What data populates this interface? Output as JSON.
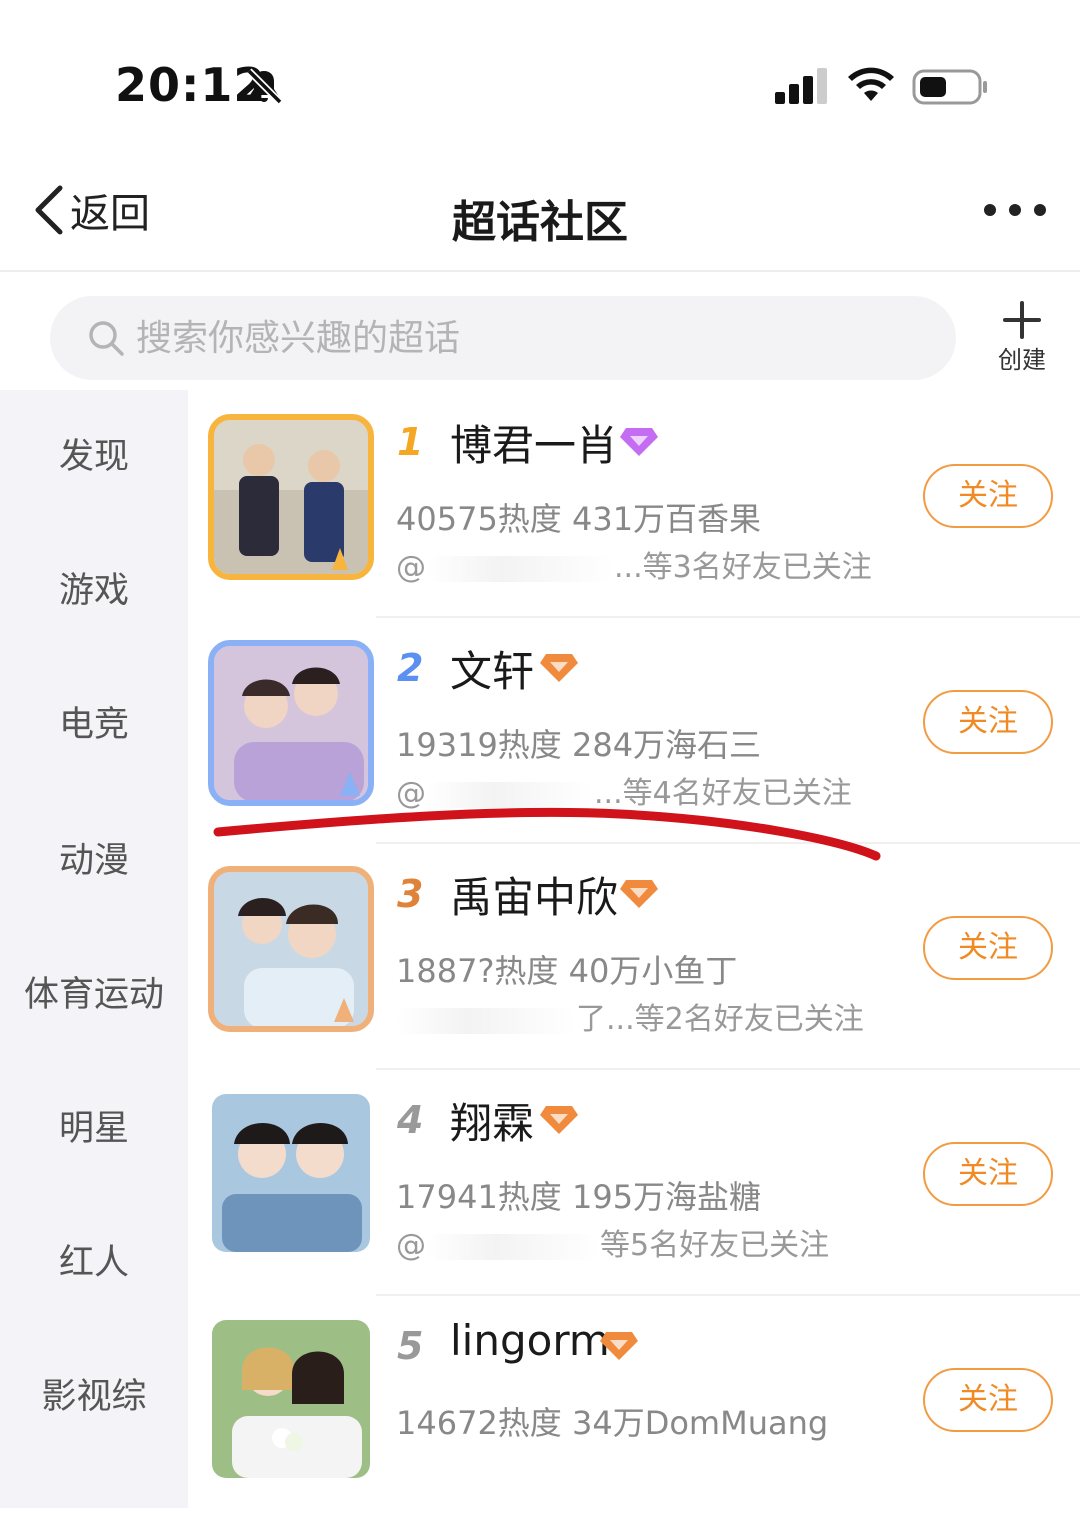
{
  "status_bar": {
    "time": "20:12"
  },
  "nav": {
    "back_label": "返回",
    "title": "超话社区"
  },
  "search": {
    "placeholder": "搜索你感兴趣的超话",
    "create_label": "创建"
  },
  "sidebar": {
    "items": [
      "发现",
      "游戏",
      "电竞",
      "动漫",
      "体育运动",
      "明星",
      "红人",
      "影视综"
    ]
  },
  "topics": [
    {
      "rank": "1",
      "name": "博君一肖",
      "stats": "40575热度 431万百香果",
      "friends_prefix": "@",
      "friends_suffix": "...等3名好友已关注",
      "follow": "关注",
      "badge": "purple-gem-icon",
      "rank_color": "#f5a623"
    },
    {
      "rank": "2",
      "name": "文轩",
      "stats": "19319热度 284万海石三",
      "friends_prefix": "@",
      "friends_suffix": "...等4名好友已关注",
      "follow": "关注",
      "badge": "orange-gem-icon",
      "rank_color": "#5b8ff0"
    },
    {
      "rank": "3",
      "name": "禹宙中欣",
      "stats": "1887?热度 40万小鱼丁",
      "friends_prefix": "",
      "friends_suffix": "了...等2名好友已关注",
      "follow": "关注",
      "badge": "orange-gem-icon",
      "rank_color": "#e0833a"
    },
    {
      "rank": "4",
      "name": "翔霖",
      "stats": "17941热度 195万海盐糖",
      "friends_prefix": "@",
      "friends_suffix": "等5名好友已关注",
      "follow": "关注",
      "badge": "orange-gem-icon",
      "rank_color": "#999999"
    },
    {
      "rank": "5",
      "name": "lingorm",
      "stats": "14672热度 34万DomMuang",
      "friends_prefix": "",
      "friends_suffix": "",
      "follow": "关注",
      "badge": "orange-gem-icon",
      "rank_color": "#999999"
    }
  ],
  "colors": {
    "accent": "#f08a24",
    "annotation_line": "#d0121b",
    "sidebar_bg": "#f4f4f8"
  }
}
